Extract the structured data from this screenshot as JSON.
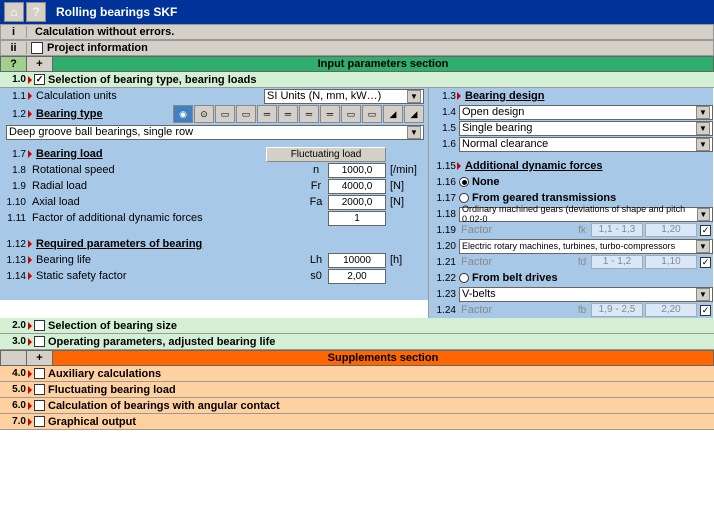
{
  "title": "Rolling bearings SKF",
  "status": {
    "i": "i",
    "i_text": "Calculation without errors.",
    "ii": "ii",
    "ii_text": "Project information"
  },
  "input_section": "Input parameters section",
  "supp_section": "Supplements section",
  "s10": {
    "num": "1.0",
    "text": "Selection of bearing type, bearing loads",
    "checked": "✓"
  },
  "s11": {
    "num": "1.1",
    "label": "Calculation units",
    "value": "SI Units (N, mm, kW…)"
  },
  "s12": {
    "num": "1.2",
    "label": "Bearing type",
    "value": "Deep groove ball bearings, single row"
  },
  "s13": {
    "num": "1.3",
    "label": "Bearing design"
  },
  "s14": {
    "num": "1.4",
    "value": "Open design"
  },
  "s15": {
    "num": "1.5",
    "value": "Single bearing"
  },
  "s16": {
    "num": "1.6",
    "value": "Normal clearance"
  },
  "s17": {
    "num": "1.7",
    "label": "Bearing load",
    "btn": "Fluctuating load"
  },
  "s18": {
    "num": "1.8",
    "label": "Rotational speed",
    "sym": "n",
    "val": "1000,0",
    "unit": "[/min]"
  },
  "s19": {
    "num": "1.9",
    "label": "Radial load",
    "sym": "Fr",
    "val": "4000,0",
    "unit": "[N]"
  },
  "s110": {
    "num": "1.10",
    "label": "Axial load",
    "sym": "Fa",
    "val": "2000,0",
    "unit": "[N]"
  },
  "s111": {
    "num": "1.11",
    "label": "Factor of additional dynamic forces",
    "val": "1"
  },
  "s112": {
    "num": "1.12",
    "label": "Required parameters of bearing"
  },
  "s113": {
    "num": "1.13",
    "label": "Bearing life",
    "sym": "Lh",
    "val": "10000",
    "unit": "[h]"
  },
  "s114": {
    "num": "1.14",
    "label": "Static safety factor",
    "sym": "s0",
    "val": "2,00"
  },
  "s115": {
    "num": "1.15",
    "label": "Additional dynamic forces"
  },
  "s116": {
    "num": "1.16",
    "label": "None"
  },
  "s117": {
    "num": "1.17",
    "label": "From geared transmissions"
  },
  "s118": {
    "num": "1.18",
    "value": "Ordinary machined gears (deviations of shape and pitch 0.02-0"
  },
  "s119": {
    "num": "1.19",
    "label": "Factor",
    "sym": "fk",
    "r1": "1,1 - 1,3",
    "r2": "1,20"
  },
  "s120": {
    "num": "1.20",
    "value": "Electric rotary machines, turbines, turbo-compressors"
  },
  "s121": {
    "num": "1.21",
    "label": "Factor",
    "sym": "fd",
    "r1": "1 - 1,2",
    "r2": "1,10"
  },
  "s122": {
    "num": "1.22",
    "label": "From belt drives"
  },
  "s123": {
    "num": "1.23",
    "value": "V-belts"
  },
  "s124": {
    "num": "1.24",
    "label": "Factor",
    "sym": "fb",
    "r1": "1,9 - 2,5",
    "r2": "2,20"
  },
  "s20": {
    "num": "2.0",
    "text": "Selection of bearing size"
  },
  "s30": {
    "num": "3.0",
    "text": "Operating parameters, adjusted bearing life"
  },
  "s40": {
    "num": "4.0",
    "text": "Auxiliary calculations"
  },
  "s50": {
    "num": "5.0",
    "text": "Fluctuating bearing load"
  },
  "s60": {
    "num": "6.0",
    "text": "Calculation of bearings with angular contact"
  },
  "s70": {
    "num": "7.0",
    "text": "Graphical output"
  }
}
